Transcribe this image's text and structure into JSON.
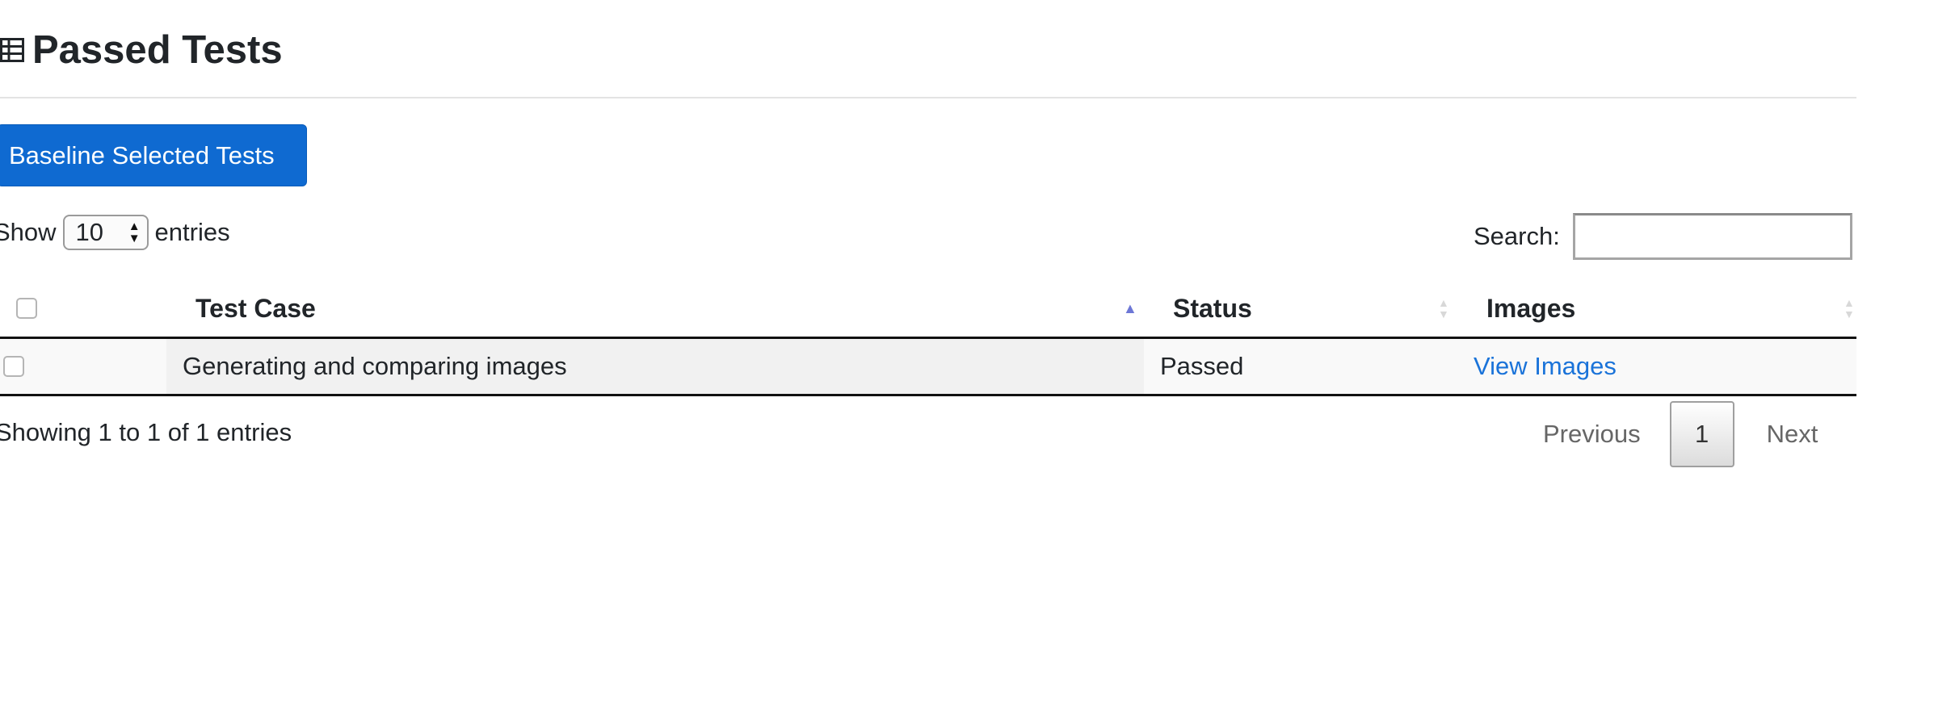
{
  "header": {
    "title": "Passed Tests",
    "icon": "table-icon"
  },
  "toolbar": {
    "baseline_label": "Baseline Selected Tests",
    "accent_color": "#0f6ad1"
  },
  "length": {
    "prefix": "Show",
    "value": "10",
    "suffix": "entries"
  },
  "search": {
    "label": "Search:",
    "value": ""
  },
  "table": {
    "columns": [
      "Test Case",
      "Status",
      "Images"
    ],
    "sorted_column": "Test Case",
    "sort_direction": "ascending",
    "rows": [
      {
        "test_case": "Generating and comparing images",
        "status": "Passed",
        "images_link": "View Images"
      }
    ]
  },
  "info": {
    "text": "Showing 1 to 1 of 1 entries"
  },
  "pagination": {
    "previous": "Previous",
    "current": "1",
    "next": "Next"
  }
}
